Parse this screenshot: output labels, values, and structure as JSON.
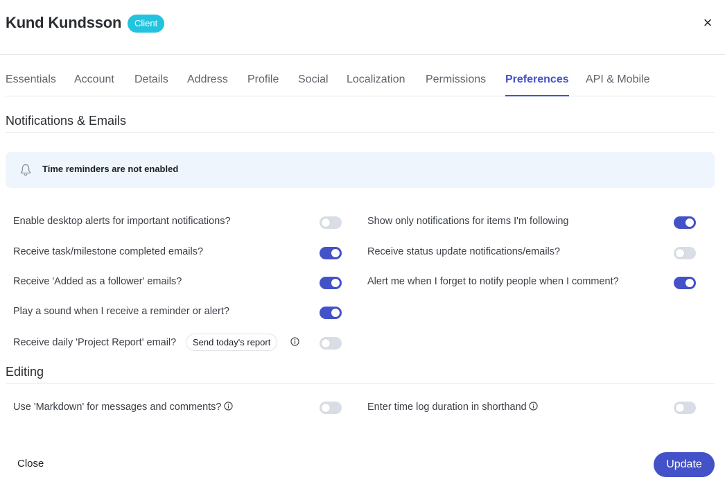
{
  "header": {
    "title": "Kund Kundsson",
    "badge": "Client",
    "close_glyph": "×"
  },
  "tabs": [
    {
      "label": "Essentials",
      "active": false
    },
    {
      "label": "Account",
      "active": false
    },
    {
      "label": "Details",
      "active": false
    },
    {
      "label": "Address",
      "active": false
    },
    {
      "label": "Profile",
      "active": false
    },
    {
      "label": "Social",
      "active": false
    },
    {
      "label": "Localization",
      "active": false
    },
    {
      "label": "Permissions",
      "active": false
    },
    {
      "label": "Preferences",
      "active": true
    },
    {
      "label": "API & Mobile",
      "active": false
    }
  ],
  "notifications": {
    "title": "Notifications & Emails",
    "alert": {
      "icon": "bell-icon",
      "text": "Time reminders are not enabled"
    },
    "left": [
      {
        "label": "Enable desktop alerts for important notifications?",
        "enabled": false
      },
      {
        "label": "Receive task/milestone completed emails?",
        "enabled": true
      },
      {
        "label": "Receive 'Added as a follower' emails?",
        "enabled": true
      },
      {
        "label": "Play a sound when I receive a reminder or alert?",
        "enabled": true
      },
      {
        "label": "Receive daily 'Project Report' email?",
        "enabled": false,
        "action": "Send today's report",
        "info_icon": "info-icon"
      }
    ],
    "right": [
      {
        "label": "Show only notifications for items I'm following",
        "enabled": true
      },
      {
        "label": "Receive status update notifications/emails?",
        "enabled": false
      },
      {
        "label": "Alert me when I forget to notify people when I comment?",
        "enabled": true
      }
    ]
  },
  "editing": {
    "title": "Editing",
    "left": [
      {
        "label": "Use 'Markdown' for messages and comments?",
        "enabled": false,
        "info_icon": "info-icon"
      }
    ],
    "right": [
      {
        "label": "Enter time log duration in shorthand",
        "enabled": false,
        "info_icon": "info-icon"
      }
    ]
  },
  "footer": {
    "close_label": "Close",
    "update_label": "Update"
  },
  "colors": {
    "accent": "#4352c8",
    "badge": "#22c3de",
    "alert_bg": "#eff5fd",
    "toggle_off": "#d9dde5"
  }
}
